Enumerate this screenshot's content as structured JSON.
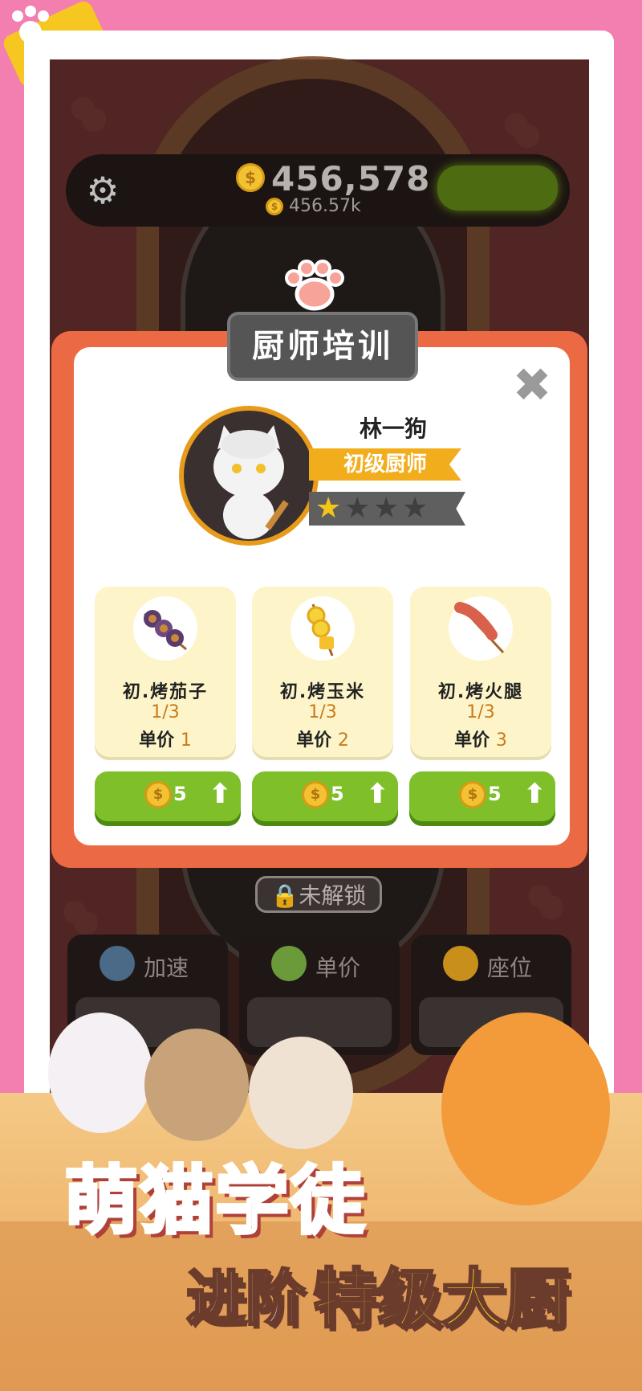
{
  "hud": {
    "coin_total": "456,578",
    "coin_rate": "456.57k",
    "coin_symbol": "$"
  },
  "modal": {
    "title": "厨师培训",
    "close_icon": "close-icon",
    "chef": {
      "name": "林一狗",
      "rank": "初级厨师",
      "stars_filled": 1,
      "stars_total": 4
    },
    "dishes": [
      {
        "name": "初.烤茄子",
        "progress": "1/3",
        "price_label": "单价",
        "price": "1",
        "upgrade_cost": "5"
      },
      {
        "name": "初.烤玉米",
        "progress": "1/3",
        "price_label": "单价",
        "price": "2",
        "upgrade_cost": "5"
      },
      {
        "name": "初.烤火腿",
        "progress": "1/3",
        "price_label": "单价",
        "price": "3",
        "upgrade_cost": "5"
      }
    ]
  },
  "game": {
    "locked_label": "未解锁",
    "upgrade_tabs": [
      {
        "label": "加速",
        "icon": "clock-icon"
      },
      {
        "label": "单价",
        "icon": "skewer-icon"
      },
      {
        "label": "座位",
        "icon": "paw-icon"
      }
    ]
  },
  "promo": {
    "line1": "萌猫学徒",
    "line2a": "进阶",
    "line2b": "特级大厨"
  },
  "colors": {
    "accent_orange": "#ec6a43",
    "rank_gold": "#f2ad1d",
    "button_green": "#7fbf2a",
    "background_pink": "#f27fb0"
  }
}
